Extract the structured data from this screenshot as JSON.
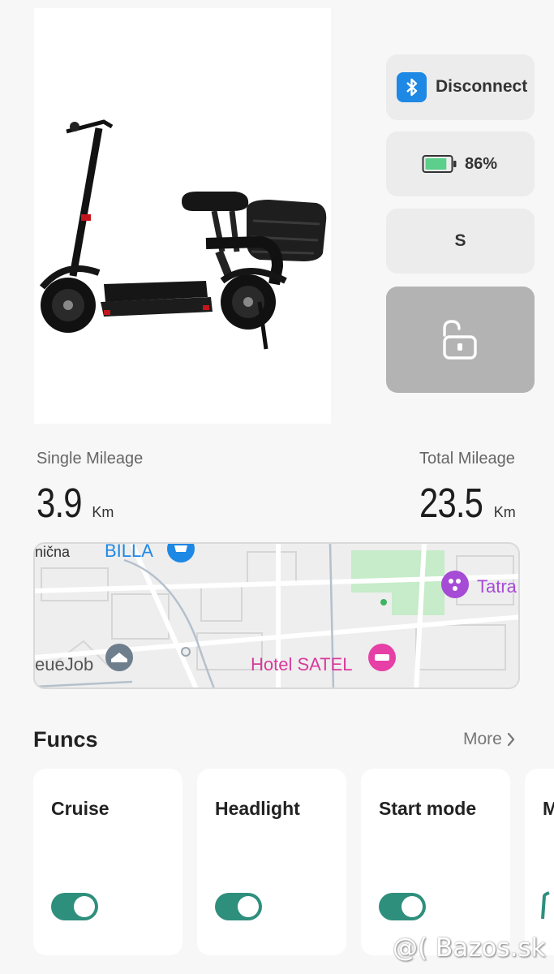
{
  "device": {
    "connection_label": "Disconnect",
    "battery_percent": "86%",
    "battery_level": 0.86,
    "speed_mode": "S",
    "lock_state": "unlocked",
    "bluetooth_color": "#1e88e5",
    "battery_color": "#5ccf8a"
  },
  "mileage": {
    "single": {
      "label": "Single Mileage",
      "value": "3.9",
      "unit": "Km"
    },
    "total": {
      "label": "Total Mileage",
      "value": "23.5",
      "unit": "Km"
    }
  },
  "map": {
    "labels": {
      "street": "nična",
      "store": "BILLA",
      "hotel": "Hotel SATEL",
      "place": "Tatra",
      "job": "eueJob"
    }
  },
  "funcs": {
    "title": "Funcs",
    "more_label": "More",
    "accent_color": "#2e8f7d",
    "items": [
      {
        "label": "Cruise",
        "enabled": true
      },
      {
        "label": "Headlight",
        "enabled": true
      },
      {
        "label": "Start mode",
        "enabled": true
      },
      {
        "label": "M",
        "enabled": true
      }
    ]
  },
  "watermark": "@( Bazos.sk"
}
